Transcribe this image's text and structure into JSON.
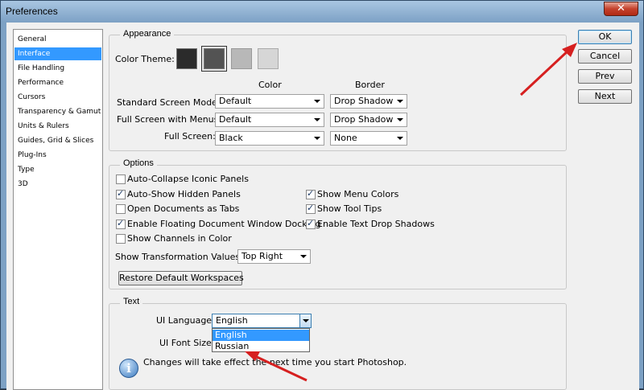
{
  "window": {
    "title": "Preferences",
    "close_glyph": "✕"
  },
  "sidebar": {
    "items": [
      {
        "label": "General"
      },
      {
        "label": "Interface",
        "selected": true
      },
      {
        "label": "File Handling"
      },
      {
        "label": "Performance"
      },
      {
        "label": "Cursors"
      },
      {
        "label": "Transparency & Gamut"
      },
      {
        "label": "Units & Rulers"
      },
      {
        "label": "Guides, Grid & Slices"
      },
      {
        "label": "Plug-Ins"
      },
      {
        "label": "Type"
      },
      {
        "label": "3D"
      }
    ]
  },
  "appearance": {
    "title": "Appearance",
    "color_theme_label": "Color Theme:",
    "themes": [
      "#2b2b2b",
      "#535353",
      "#b8b8b8",
      "#d6d6d6"
    ],
    "color_header": "Color",
    "border_header": "Border",
    "rows": [
      {
        "label": "Standard Screen Mode:",
        "color": "Default",
        "border": "Drop Shadow"
      },
      {
        "label": "Full Screen with Menus:",
        "color": "Default",
        "border": "Drop Shadow"
      },
      {
        "label": "Full Screen:",
        "color": "Black",
        "border": "None"
      }
    ]
  },
  "options": {
    "title": "Options",
    "checks": [
      {
        "label": "Auto-Collapse Iconic Panels",
        "checked": false
      },
      {
        "label": "Auto-Show Hidden Panels",
        "checked": true
      },
      {
        "label": "Open Documents as Tabs",
        "checked": false
      },
      {
        "label": "Enable Floating Document Window Docking",
        "checked": true
      },
      {
        "label": "Show Channels in Color",
        "checked": false
      },
      {
        "label": "Show Menu Colors",
        "checked": true
      },
      {
        "label": "Show Tool Tips",
        "checked": true
      },
      {
        "label": "Enable Text Drop Shadows",
        "checked": true
      }
    ],
    "transform_label": "Show Transformation Values:",
    "transform_value": "Top Right",
    "restore_button": "Restore Default Workspaces"
  },
  "text": {
    "title": "Text",
    "ui_language_label": "UI Language:",
    "ui_language_value": "English",
    "ui_font_size_label": "UI Font Size:",
    "language_options": [
      "English",
      "Russian"
    ],
    "notice": "Changes will take effect the next time you start Photoshop."
  },
  "buttons": {
    "ok": "OK",
    "cancel": "Cancel",
    "prev": "Prev",
    "next": "Next"
  },
  "annotations": {
    "arrow_color": "#d62020"
  },
  "icons": {
    "info": "i",
    "checkmark": "✓"
  }
}
